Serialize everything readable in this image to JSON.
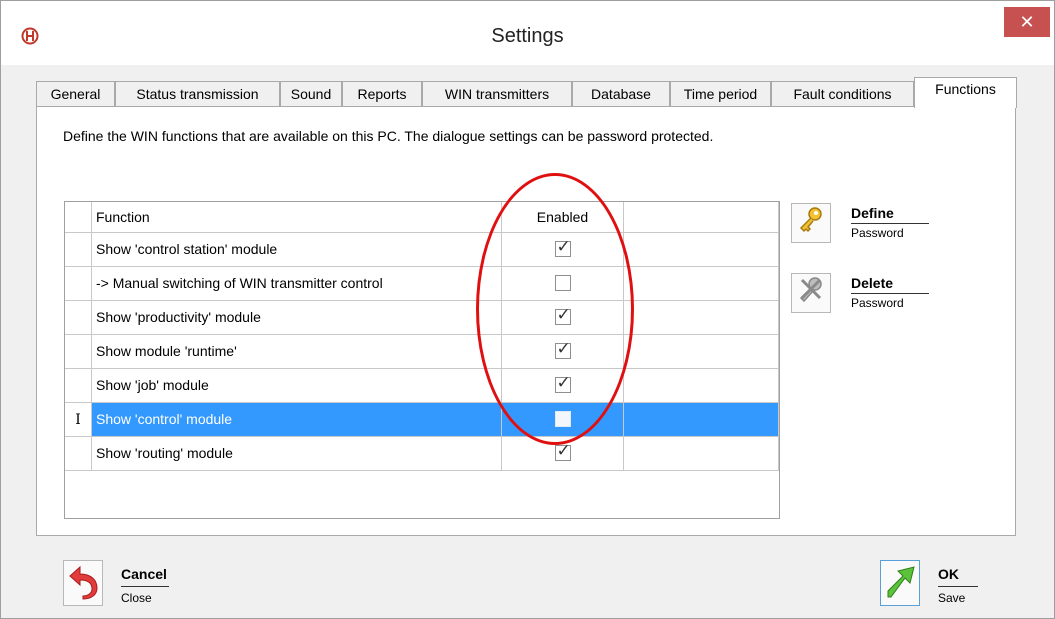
{
  "window": {
    "title": "Settings",
    "app_icon": "app-logo-icon",
    "close_glyph": "✕"
  },
  "tabs": [
    {
      "label": "General"
    },
    {
      "label": "Status transmission"
    },
    {
      "label": "Sound"
    },
    {
      "label": "Reports"
    },
    {
      "label": "WIN transmitters"
    },
    {
      "label": "Database"
    },
    {
      "label": "Time period"
    },
    {
      "label": "Fault conditions"
    },
    {
      "label": "Functions",
      "active": true
    }
  ],
  "panel": {
    "description": "Define the WIN functions that are available on this PC. The dialogue settings can be password protected."
  },
  "grid": {
    "columns": [
      "Function",
      "Enabled"
    ],
    "rows": [
      {
        "function": "Show 'control station' module",
        "enabled": true
      },
      {
        "function": "-> Manual switching of WIN transmitter control",
        "enabled": false
      },
      {
        "function": "Show 'productivity' module",
        "enabled": true
      },
      {
        "function": "Show module 'runtime'",
        "enabled": true
      },
      {
        "function": "Show 'job' module",
        "enabled": true
      },
      {
        "function": "Show 'control' module",
        "enabled": false,
        "selected": true,
        "marker": "I"
      },
      {
        "function": "Show 'routing' module",
        "enabled": true
      }
    ]
  },
  "actions": {
    "define": {
      "title": "Define",
      "subtitle": "Password",
      "icon": "key-icon"
    },
    "delete": {
      "title": "Delete",
      "subtitle": "Password",
      "icon": "delete-key-icon"
    }
  },
  "footer": {
    "cancel": {
      "title": "Cancel",
      "subtitle": "Close",
      "icon": "undo-arrow-icon"
    },
    "ok": {
      "title": "OK",
      "subtitle": "Save",
      "icon": "green-arrow-icon"
    }
  },
  "colors": {
    "selection": "#3399ff",
    "annotation": "#e01010",
    "close_button": "#c75050"
  }
}
